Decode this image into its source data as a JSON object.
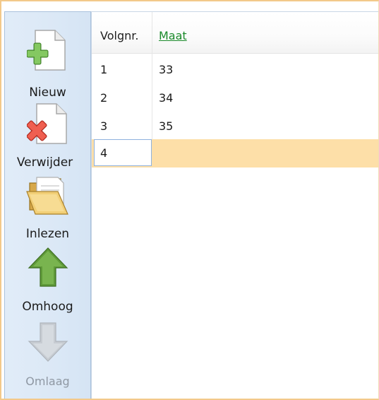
{
  "toolbar": {
    "new_label": "Nieuw",
    "delete_label": "Verwijder",
    "import_label": "Inlezen",
    "up_label": "Omhoog",
    "down_label": "Omlaag"
  },
  "grid": {
    "columns": [
      "Volgnr.",
      "Maat"
    ],
    "rows": [
      {
        "nr": "1",
        "maat": "33"
      },
      {
        "nr": "2",
        "maat": "34"
      },
      {
        "nr": "3",
        "maat": "35"
      },
      {
        "nr": "4",
        "maat": ""
      }
    ],
    "active_row_index": 3
  },
  "colors": {
    "frame_border": "#f3c98a",
    "toolbar_bg": "#dbe8f6",
    "active_row": "#fddfa8",
    "sort_link": "#1a8a2a"
  },
  "icons": {
    "new": "document-add-icon",
    "delete": "document-delete-icon",
    "import": "folder-open-icon",
    "up": "arrow-up-icon",
    "down": "arrow-down-icon"
  }
}
